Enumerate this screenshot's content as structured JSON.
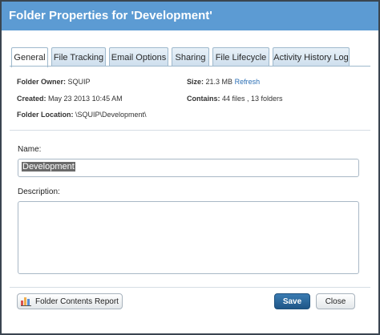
{
  "dialog": {
    "title": "Folder Properties for 'Development'",
    "close_glyph": "✕"
  },
  "tabs": [
    {
      "label": "General",
      "active": true
    },
    {
      "label": "File Tracking"
    },
    {
      "label": "Email Options"
    },
    {
      "label": "Sharing"
    },
    {
      "label": "File Lifecycle"
    },
    {
      "label": "Activity History Log"
    }
  ],
  "info": {
    "owner_label": "Folder Owner:",
    "owner_value": "SQUIP",
    "created_label": "Created:",
    "created_value": "May 23 2013 10:45 AM",
    "location_label": "Folder Location:",
    "location_value": "\\SQUIP\\Development\\",
    "size_label": "Size:",
    "size_value": "21.3 MB",
    "refresh_link": "Refresh",
    "contains_label": "Contains:",
    "contains_value": "44 files , 13 folders"
  },
  "form": {
    "name_label": "Name:",
    "name_value": "Development",
    "description_label": "Description:",
    "description_value": ""
  },
  "buttons": {
    "report": "Folder Contents Report",
    "save": "Save",
    "close": "Close"
  },
  "colors": {
    "titlebar": "#5c9bd3",
    "primary_button": "#1f5687",
    "link": "#2b6fb5"
  },
  "icons": {
    "report": "bar-chart-icon",
    "close": "close-icon"
  }
}
